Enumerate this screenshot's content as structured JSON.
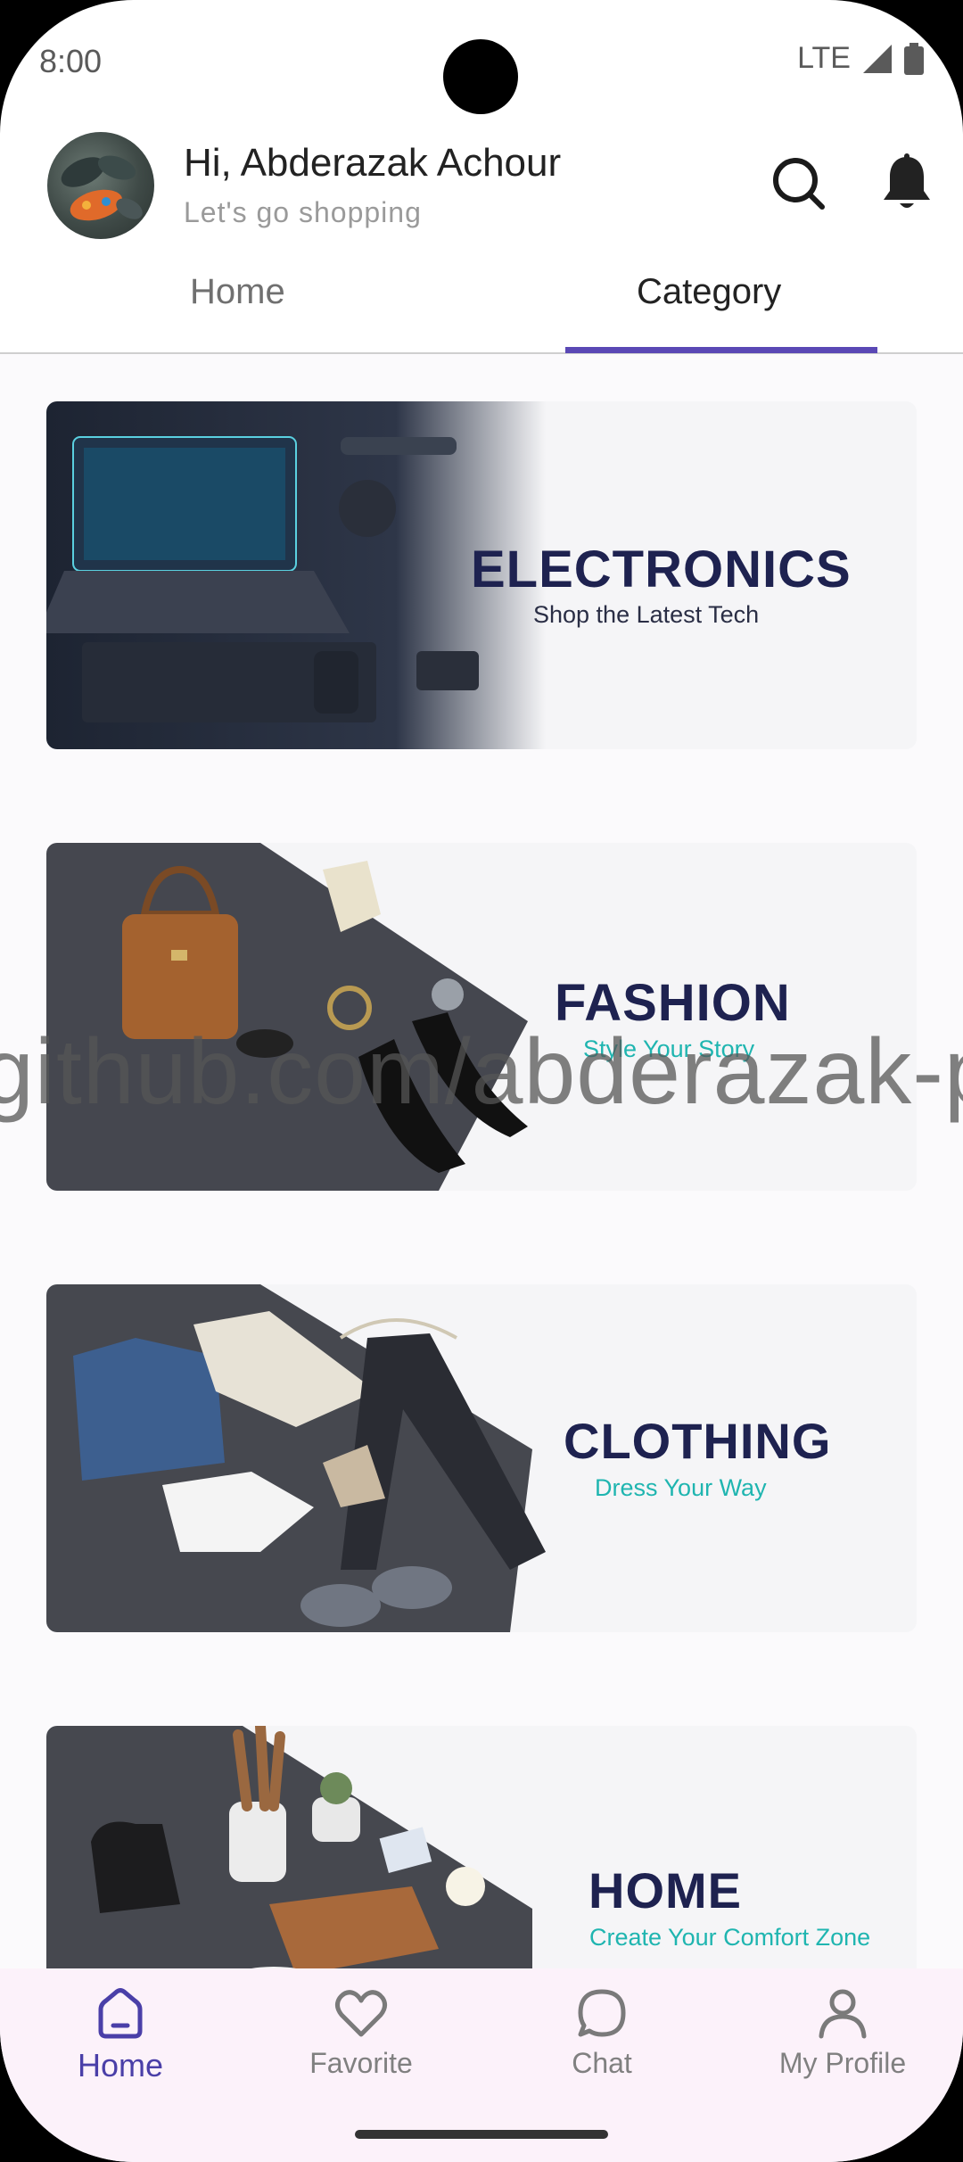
{
  "status": {
    "time": "8:00",
    "network": "LTE"
  },
  "header": {
    "greeting": "Hi, Abderazak Achour",
    "subtitle": "Let's go shopping"
  },
  "tabs": [
    {
      "label": "Home"
    },
    {
      "label": "Category",
      "selected": true
    }
  ],
  "categories": [
    {
      "title": "ELECTRONICS",
      "tagline": "Shop the Latest Tech"
    },
    {
      "title": "FASHION",
      "tagline": "Style Your Story"
    },
    {
      "title": "CLOTHING",
      "tagline": "Dress Your Way"
    },
    {
      "title": "HOME",
      "tagline": "Create Your Comfort Zone"
    }
  ],
  "watermark": "github.com/abderazak-py",
  "bottom_nav": [
    {
      "label": "Home",
      "icon": "home-icon",
      "active": true
    },
    {
      "label": "Favorite",
      "icon": "heart-icon"
    },
    {
      "label": "Chat",
      "icon": "chat-icon"
    },
    {
      "label": "My Profile",
      "icon": "profile-icon"
    }
  ],
  "colors": {
    "accent": "#5a48b5",
    "brand_text": "#1e2250",
    "teal": "#1fb5b0"
  }
}
